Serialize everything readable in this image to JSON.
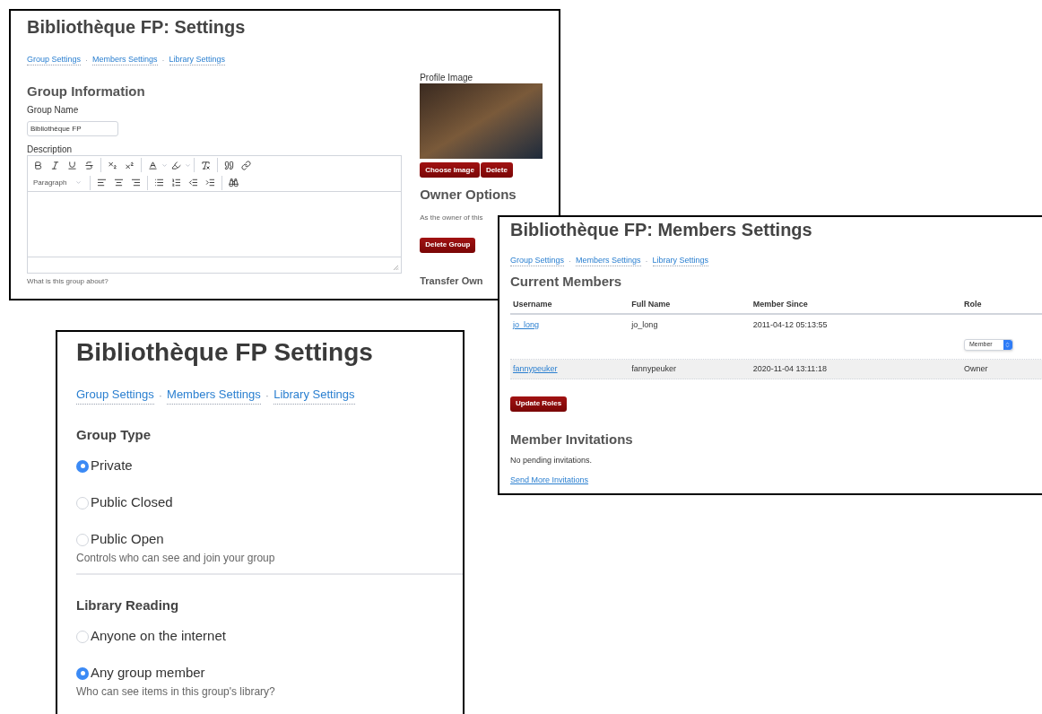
{
  "group_settings_window": {
    "title": "Bibliothèque FP: Settings",
    "nav": {
      "separator": "·",
      "links": [
        "Group Settings",
        "Members Settings",
        "Library Settings"
      ]
    },
    "group_information": {
      "title": "Group Information",
      "name_label": "Group Name",
      "name_value": "Bibliothèque FP",
      "description_label": "Description",
      "block_format": "Paragraph",
      "hint": "What is this group about?"
    },
    "profile_image": {
      "label": "Profile Image",
      "buttons": [
        "Choose Image",
        "Delete"
      ]
    },
    "owner_options": {
      "title": "Owner Options",
      "text": "As the owner of this",
      "button": "Delete Group"
    },
    "transfer_title": "Transfer Own"
  },
  "members_settings_window": {
    "title": "Bibliothèque FP: Members Settings",
    "nav": {
      "separator": "·",
      "links": [
        "Group Settings",
        "Members Settings",
        "Library Settings"
      ]
    },
    "current_members": {
      "title": "Current Members",
      "columns": [
        "Username",
        "Full Name",
        "Member Since",
        "Role"
      ],
      "rows": [
        {
          "username": "jo_long",
          "full_name": "jo_long",
          "member_since": "2011-04-12 05:13:55",
          "role": {
            "kind": "select",
            "value": "Member"
          }
        },
        {
          "username": "fannypeuker",
          "full_name": "fannypeuker",
          "member_since": "2020-11-04 13:11:18",
          "role": {
            "kind": "text",
            "value": "Owner"
          }
        }
      ],
      "button": "Update Roles"
    },
    "invitations": {
      "title": "Member Invitations",
      "text": "No pending invitations.",
      "link": "Send More Invitations"
    }
  },
  "group_type_window": {
    "title": "Bibliothèque FP Settings",
    "nav": {
      "separator": "·",
      "links": [
        "Group Settings",
        "Members Settings",
        "Library Settings"
      ]
    },
    "sections": [
      {
        "title": "Group Type",
        "options": [
          {
            "label": "Private",
            "selected": true
          },
          {
            "label": "Public Closed",
            "selected": false
          },
          {
            "label": "Public Open",
            "selected": false
          }
        ],
        "hint": "Controls who can see and join your group"
      },
      {
        "title": "Library Reading",
        "options": [
          {
            "label": "Anyone on the internet",
            "selected": false
          },
          {
            "label": "Any group member",
            "selected": true
          }
        ],
        "hint": "Who can see items in this group's library?"
      }
    ]
  }
}
